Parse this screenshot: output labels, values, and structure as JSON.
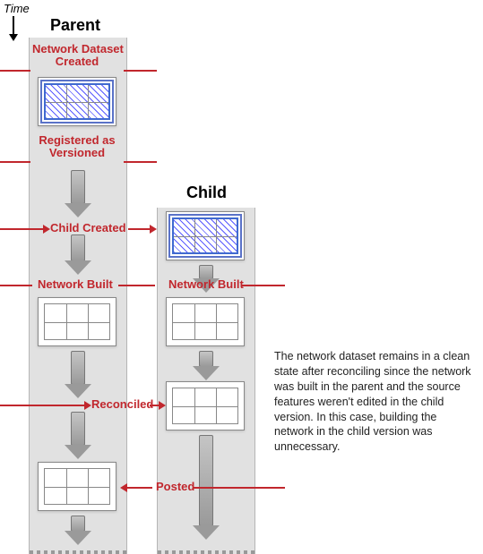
{
  "time_label": "Time",
  "headers": {
    "parent": "Parent",
    "child": "Child"
  },
  "labels": {
    "network_dataset_created": "Network Dataset\nCreated",
    "registered_as_versioned": "Registered as\nVersioned",
    "child_created": "Child Created",
    "network_built_parent": "Network Built",
    "network_built_child": "Network Built",
    "reconciled": "Reconciled",
    "posted": "Posted"
  },
  "explain": "The network dataset remains in a clean state after reconciling since the network was built in the parent and the source features weren't edited in the child version. In this case, building the network in the child version was unnecessary.",
  "chart_data": {
    "type": "table",
    "title": "Versioned network dataset lifecycle across Parent and Child versions",
    "columns": [
      "Parent",
      "Child"
    ],
    "events": [
      {
        "t": 1,
        "column": "Parent",
        "event": "Network Dataset Created",
        "state": "dirty"
      },
      {
        "t": 2,
        "column": "Parent",
        "event": "Registered as Versioned",
        "state": "dirty"
      },
      {
        "t": 3,
        "column": "Parent→Child",
        "event": "Child Created",
        "state": "dirty"
      },
      {
        "t": 4,
        "column": "Parent",
        "event": "Network Built",
        "state": "clean"
      },
      {
        "t": 4,
        "column": "Child",
        "event": "Network Built",
        "state": "clean"
      },
      {
        "t": 5,
        "column": "Child",
        "event": "Reconciled",
        "state": "clean"
      },
      {
        "t": 6,
        "column": "Child→Parent",
        "event": "Posted",
        "state": "clean"
      }
    ],
    "legend": {
      "dirty": "hatched grid (network needs build)",
      "clean": "plain grid (network built)"
    }
  }
}
